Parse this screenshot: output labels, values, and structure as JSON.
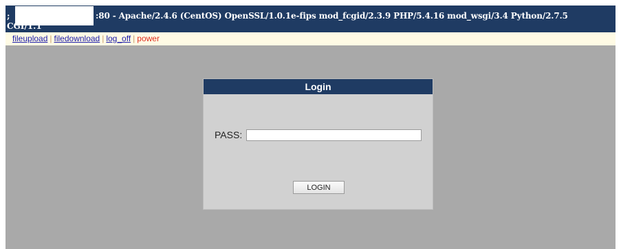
{
  "header": {
    "prefix": ";",
    "server_signature": ":80 - Apache/2.4.6 (CentOS) OpenSSL/1.0.1e-fips mod_fcgid/2.3.9 PHP/5.4.16 mod_wsgi/3.4 Python/2.7.5",
    "server_signature_cont": "CGI/1.1"
  },
  "nav": {
    "items": [
      {
        "label": "fileupload"
      },
      {
        "label": "filedownload"
      },
      {
        "label": "log_off"
      }
    ],
    "separator": "|",
    "power_label": "power"
  },
  "login": {
    "title": "Login",
    "pass_label": "PASS:",
    "pass_value": "",
    "button_label": "LOGIN"
  },
  "colors": {
    "header_bg": "#1f3b63",
    "nav_bg": "#fffbe5",
    "link": "#1a1aa8",
    "power": "#e03020",
    "content_bg": "#a9a9a9",
    "panel_bg": "#d1d1d1"
  }
}
